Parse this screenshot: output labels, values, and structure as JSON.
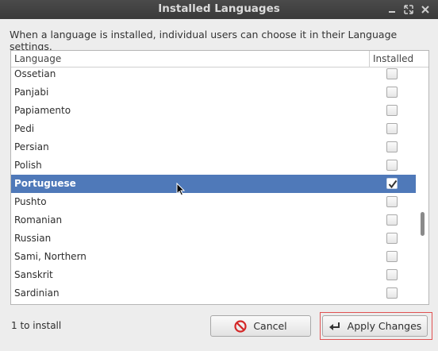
{
  "window": {
    "title": "Installed Languages"
  },
  "description": "When a language is installed, individual users can choose it in their Language settings.",
  "table": {
    "columns": [
      "Language",
      "Installed"
    ],
    "rows": [
      {
        "name": "Ossetian",
        "installed": false
      },
      {
        "name": "Panjabi",
        "installed": false
      },
      {
        "name": "Papiamento",
        "installed": false
      },
      {
        "name": "Pedi",
        "installed": false
      },
      {
        "name": "Persian",
        "installed": false
      },
      {
        "name": "Polish",
        "installed": false
      },
      {
        "name": "Portuguese",
        "installed": true,
        "selected": true
      },
      {
        "name": "Pushto",
        "installed": false
      },
      {
        "name": "Romanian",
        "installed": false
      },
      {
        "name": "Russian",
        "installed": false
      },
      {
        "name": "Sami, Northern",
        "installed": false
      },
      {
        "name": "Sanskrit",
        "installed": false
      },
      {
        "name": "Sardinian",
        "installed": false
      }
    ]
  },
  "status": "1 to install",
  "buttons": {
    "cancel": "Cancel",
    "apply": "Apply Changes"
  },
  "colors": {
    "selection": "#4f79b9",
    "focus": "#e05252",
    "cancel_icon": "#d42828"
  },
  "icons": {
    "cancel": "cancel-circle-icon",
    "apply": "return-arrow-icon",
    "minimize": "minimize-icon",
    "maximize": "maximize-icon",
    "close": "close-icon"
  }
}
